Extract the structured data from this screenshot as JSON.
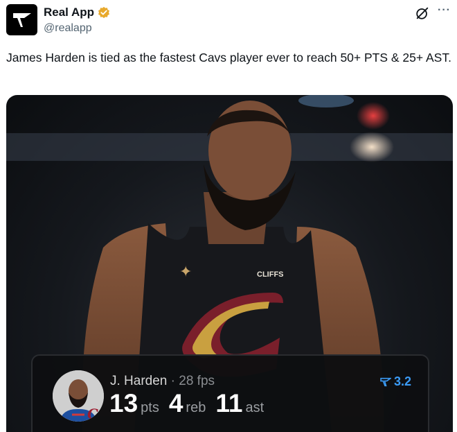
{
  "author": {
    "display_name": "Real App",
    "handle": "@realapp",
    "verified_badge_color": "#e8a92c",
    "logo_icon": "real-app-logo-icon"
  },
  "header_icons": {
    "grok": "grok-icon",
    "more": "···"
  },
  "tweet": {
    "text": "James Harden is tied as the fastest Cavs player ever to reach 50+ PTS & 25+ AST."
  },
  "stat_card": {
    "player_name": "J. Harden",
    "separator": "·",
    "fps": "28 fps",
    "rating": "3.2",
    "stats": [
      {
        "value": "13",
        "unit": "pts"
      },
      {
        "value": "4",
        "unit": "reb"
      },
      {
        "value": "11",
        "unit": "ast"
      }
    ],
    "accent_color": "#3b9bf5"
  },
  "media": {
    "jersey_sponsor": "CLIFFS"
  }
}
